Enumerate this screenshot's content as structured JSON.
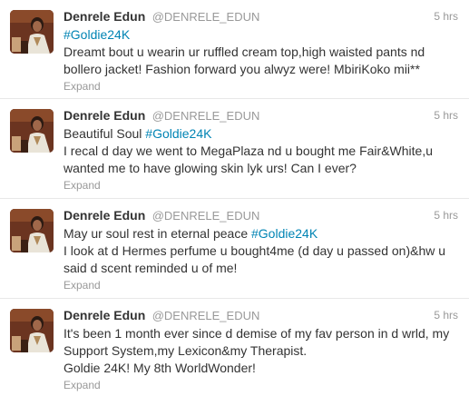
{
  "colors": {
    "link": "#0084b4",
    "muted": "#999999",
    "text": "#333333",
    "divider": "#e8e8e8"
  },
  "tweets": [
    {
      "fullname": "Denrele Edun",
      "username": "@DENRELE_EDUN",
      "time": "5 hrs",
      "lines": [
        {
          "hashtag": "#Goldie24K",
          "text": ""
        },
        {
          "hashtag": "",
          "text": "Dreamt bout u wearin ur ruffled cream top,high waisted pants nd"
        },
        {
          "hashtag": "",
          "text": "bollero jacket! Fashion forward you alwyz were! MbiriKoko mii**"
        }
      ],
      "expand": "Expand"
    },
    {
      "fullname": "Denrele Edun",
      "username": "@DENRELE_EDUN",
      "time": "5 hrs",
      "lines": [
        {
          "text": "Beautiful Soul ",
          "hashtag": "#Goldie24K"
        },
        {
          "text": "I recal d day we went to MegaPlaza nd u bought me Fair&White,u",
          "hashtag": ""
        },
        {
          "text": "wanted me to have glowing skin lyk urs! Can I ever?",
          "hashtag": ""
        }
      ],
      "expand": "Expand"
    },
    {
      "fullname": "Denrele Edun",
      "username": "@DENRELE_EDUN",
      "time": "5 hrs",
      "lines": [
        {
          "text": "May ur soul rest in eternal peace ",
          "hashtag": "#Goldie24K"
        },
        {
          "text": "I look at d Hermes perfume u bought4me (d day u passed on)&hw u",
          "hashtag": ""
        },
        {
          "text": "said d scent reminded u of me!",
          "hashtag": ""
        }
      ],
      "expand": "Expand"
    },
    {
      "fullname": "Denrele Edun",
      "username": "@DENRELE_EDUN",
      "time": "5 hrs",
      "lines": [
        {
          "text": "It's been 1 month ever since d demise of my fav person in d wrld, my",
          "hashtag": ""
        },
        {
          "text": "Support System,my Lexicon&my Therapist.",
          "hashtag": ""
        },
        {
          "text": "Goldie 24K! My 8th WorldWonder!",
          "hashtag": ""
        }
      ],
      "expand": "Expand"
    }
  ]
}
